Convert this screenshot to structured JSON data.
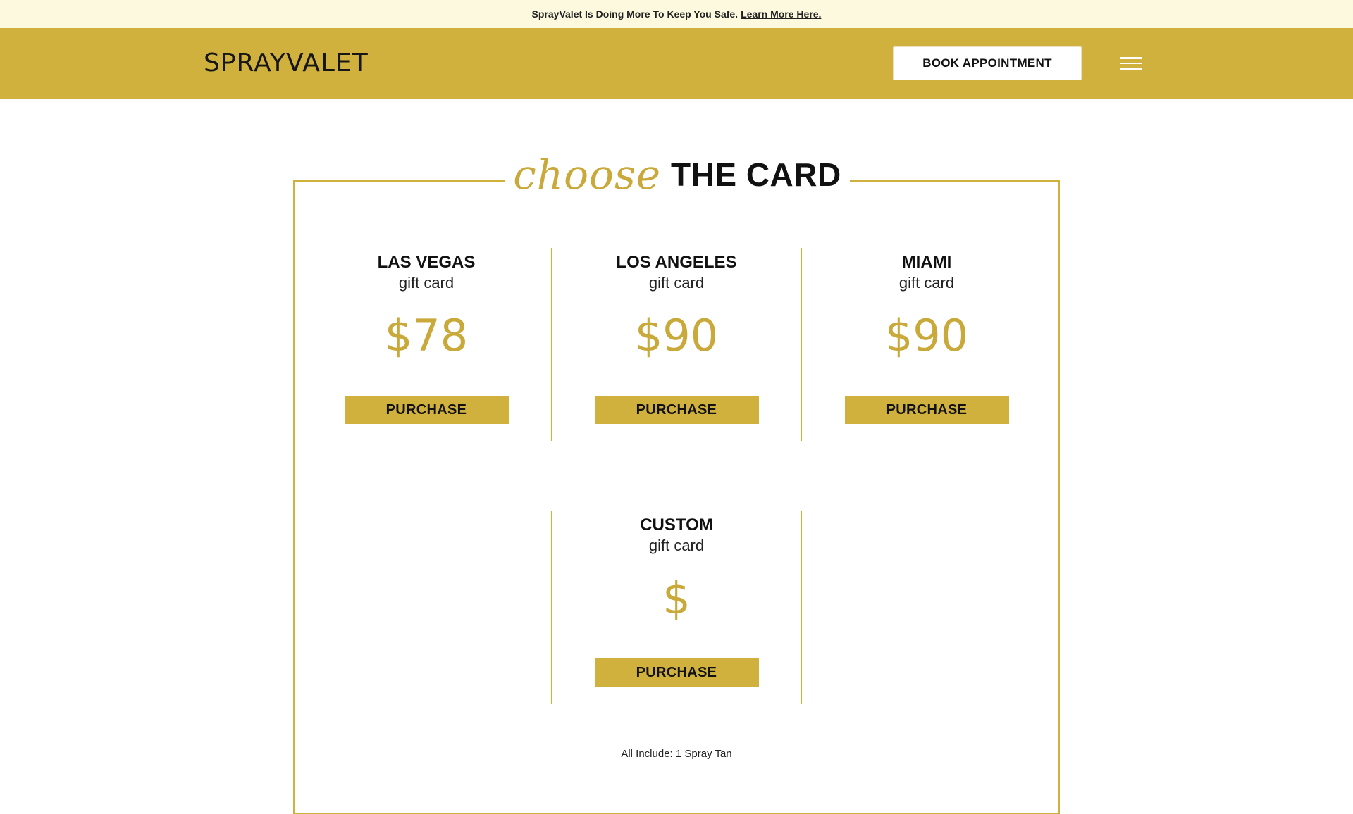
{
  "announcement": {
    "text": "SprayValet Is Doing More To Keep You Safe.",
    "link": "Learn More Here."
  },
  "header": {
    "logo": "SPRAYVALET",
    "book_label": "BOOK APPOINTMENT",
    "menu_icon": "hamburger-menu-icon"
  },
  "section": {
    "script_word": "choose",
    "title": "THE CARD"
  },
  "cards": [
    {
      "city": "LAS VEGAS",
      "sub": "gift card",
      "price": "$78",
      "button": "PURCHASE"
    },
    {
      "city": "LOS ANGELES",
      "sub": "gift card",
      "price": "$90",
      "button": "PURCHASE"
    },
    {
      "city": "MIAMI",
      "sub": "gift card",
      "price": "$90",
      "button": "PURCHASE"
    },
    {
      "city": "CUSTOM",
      "sub": "gift card",
      "price": "$",
      "button": "PURCHASE"
    }
  ],
  "footnote": "All Include: 1 Spray Tan",
  "colors": {
    "gold": "#d1b13e",
    "announce_bg": "#fdf9df",
    "price_gold": "#c9a93a"
  }
}
